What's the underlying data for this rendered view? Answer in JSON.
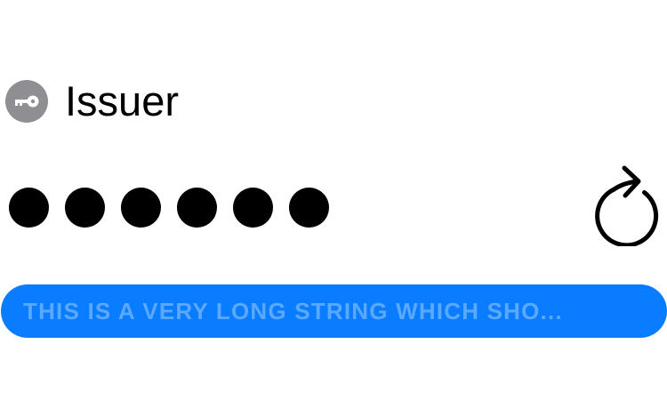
{
  "issuer": {
    "icon": "key-icon",
    "badge_color": "#8e8e93",
    "label": "Issuer"
  },
  "code": {
    "masked_digits": 6,
    "dot_color": "#000000"
  },
  "refresh": {
    "icon": "refresh-icon"
  },
  "banner": {
    "text": "THIS IS A VERY LONG STRING WHICH SHO...",
    "background": "#0a7cff",
    "text_color": "#5aa9ff"
  }
}
